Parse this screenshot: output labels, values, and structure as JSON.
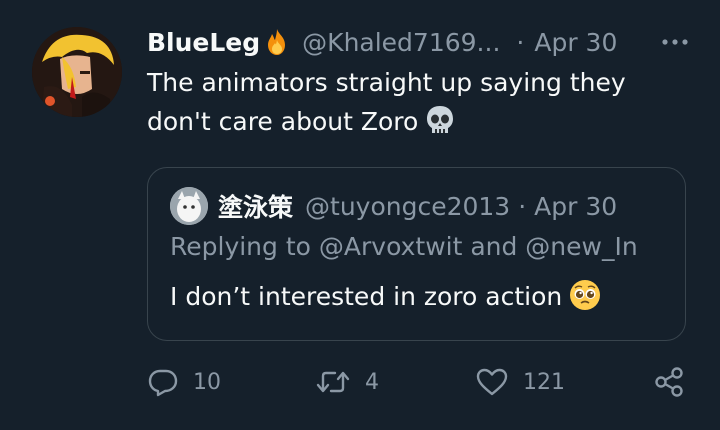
{
  "tweet": {
    "display_name": "BlueLeg",
    "handle": "@Khaled7169...",
    "separator": "·",
    "date": "Apr 30",
    "text": "The animators straight up saying they don't care about Zoro",
    "icons": {
      "name_badge": "fire-icon",
      "text_emoji": "skull-icon",
      "menu": "more-icon"
    }
  },
  "quote": {
    "display_name": "塗泳策",
    "handle": "@tuyongce2013",
    "separator": "·",
    "date": "Apr 30",
    "replying_to": "Replying to @Arvoxtwit and @new_In",
    "text": "I don’t interested in zoro action",
    "icons": {
      "text_emoji": "pleading-face-icon"
    }
  },
  "actions": {
    "replies": "10",
    "retweets": "4",
    "likes": "121",
    "icons": [
      "reply-icon",
      "retweet-icon",
      "like-icon",
      "share-icon"
    ]
  },
  "colors": {
    "background": "#15202b",
    "text_primary": "#f7f9f9",
    "text_secondary": "#8b98a5",
    "border": "#38444d"
  }
}
